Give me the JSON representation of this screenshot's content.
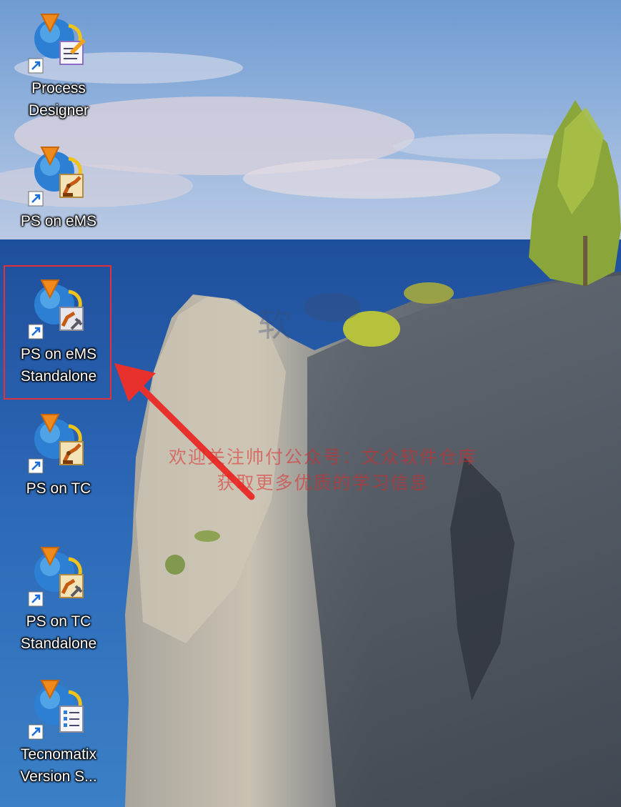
{
  "desktop": {
    "icons": [
      {
        "label": "Process\nDesigner",
        "badge": "document-pencil-icon"
      },
      {
        "label": "PS on eMS",
        "badge": "robot-arm-icon"
      },
      {
        "label": "PS on eMS\nStandalone",
        "badge": "robot-arm-plug-icon",
        "selected": true
      },
      {
        "label": "PS on TC",
        "badge": "robot-arm-icon"
      },
      {
        "label": "PS on TC\nStandalone",
        "badge": "robot-arm-plug-icon"
      },
      {
        "label": "Tecnomatix\nVersion S...",
        "badge": "checklist-icon"
      }
    ],
    "watermark": {
      "line1": "欢迎关注帅付公众号：文众软件仓库",
      "line2": "获取更多优质的学习信息"
    },
    "colors": {
      "highlight": "#e2313a",
      "arrow": "#e8302c",
      "sky": "#7fa6d6",
      "sea": "#2a63b0"
    }
  }
}
